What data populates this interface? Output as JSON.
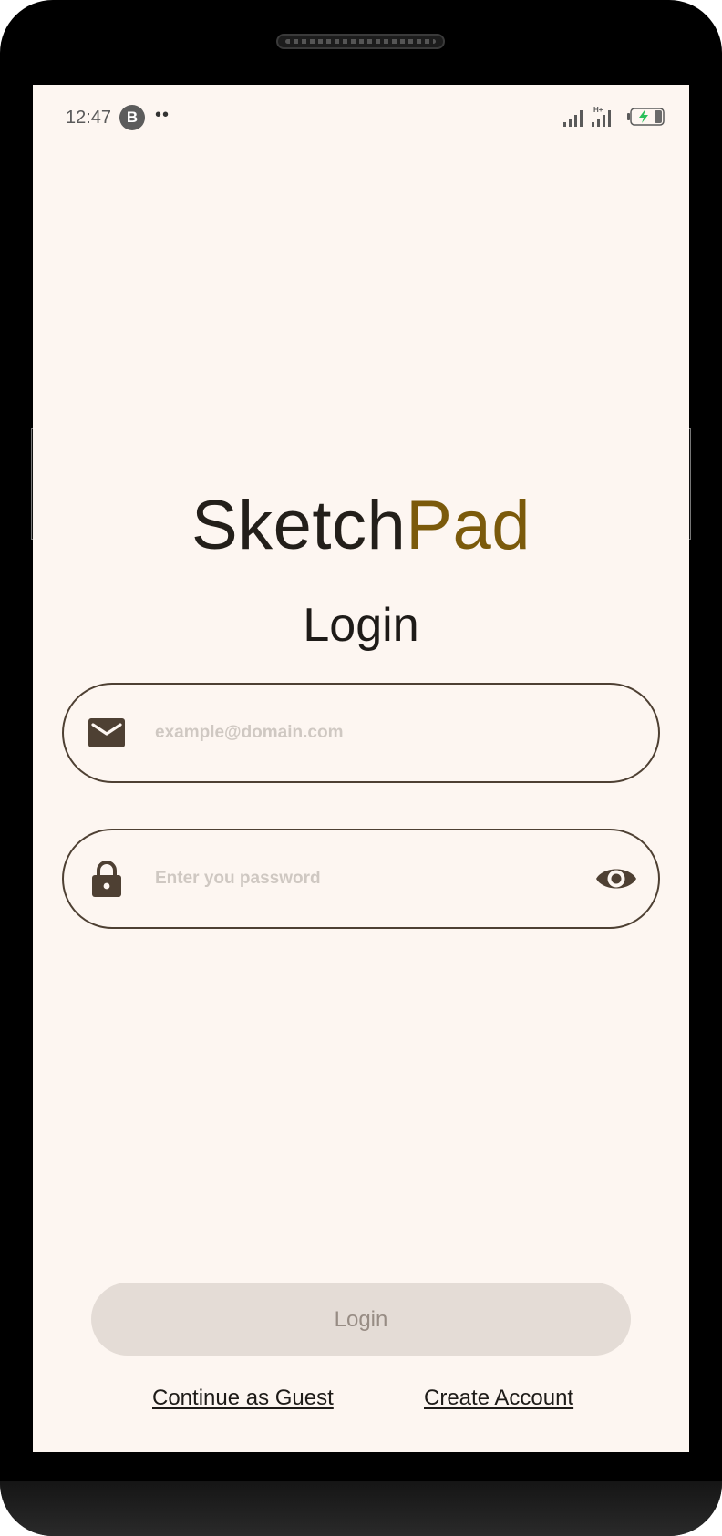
{
  "status_bar": {
    "time": "12:47",
    "app_badge": "B",
    "dots": "••",
    "icons": [
      "signal-icon",
      "signal-h-plus-icon",
      "battery-charging-icon"
    ]
  },
  "brand": {
    "part1": "Sketch",
    "part2": "Pad",
    "accent_color": "#7b5a0b"
  },
  "title": "Login",
  "email_field": {
    "icon": "mail-icon",
    "placeholder": "example@domain.com",
    "value": ""
  },
  "password_field": {
    "icon": "lock-icon",
    "placeholder": "Enter you password",
    "value": "",
    "toggle_icon": "eye-icon"
  },
  "login_button": {
    "label": "Login",
    "enabled": false
  },
  "links": {
    "guest": "Continue as Guest",
    "create": "Create Account"
  },
  "colors": {
    "background": "#fdf6f1",
    "outline": "#4e4033",
    "button_disabled": "#e4dcd6"
  }
}
